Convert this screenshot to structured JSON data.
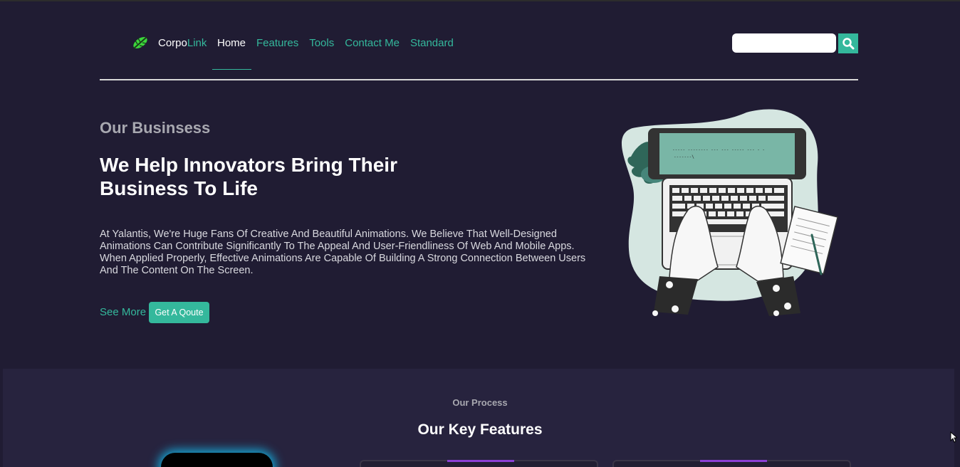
{
  "header": {
    "brand_part1": "Corpo",
    "brand_part2": "Link",
    "nav": [
      "Home",
      "Features",
      "Tools",
      "Contact Me",
      "Standard"
    ],
    "active_nav": "Home",
    "search_placeholder": ""
  },
  "hero": {
    "eyebrow": "Our Businsess",
    "headline": "We Help Innovators Bring Their Business To Life",
    "description": "At Yalantis, We're Huge Fans Of Creative And Beautiful Animations. We Believe That Well-Designed Animations Can Contribute Significantly To The Appeal And User-Friendliness Of Web And Mobile Apps. When Applied Properly, Effective Animations Are Capable Of Building A Strong Connection Between Users And The Content On The Screen.",
    "see_more": "See More",
    "quote_button": "Get A Qoute"
  },
  "process": {
    "eyebrow": "Our Process",
    "title": "Our Key Features"
  },
  "colors": {
    "background": "#201c33",
    "accent": "#34b89c",
    "section": "#27233e",
    "card_accent": "#8a3fd4",
    "glow": "#15a9d8"
  },
  "icons": [
    "leaf-logo-icon",
    "search-icon",
    "laptop-illustration",
    "mouse-cursor-icon"
  ]
}
